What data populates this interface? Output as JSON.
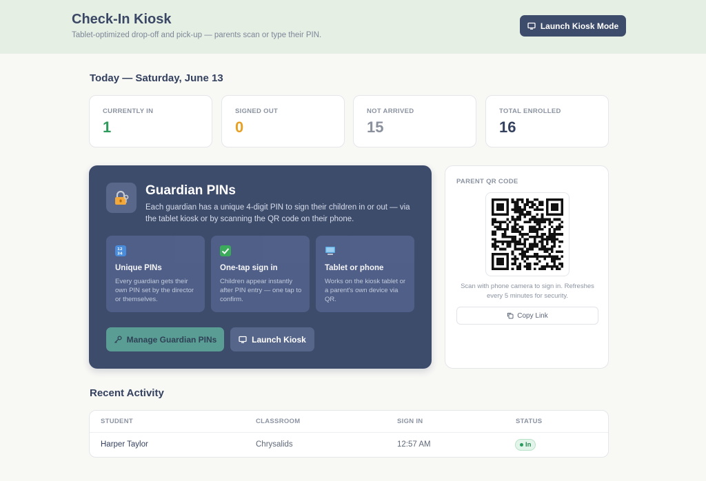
{
  "header": {
    "title": "Check-In Kiosk",
    "subtitle": "Tablet-optimized drop-off and pick-up — parents scan or type their PIN.",
    "launch_button": "Launch Kiosk Mode"
  },
  "today": {
    "heading": "Today — Saturday, June 13",
    "stats": [
      {
        "label": "CURRENTLY IN",
        "value": "1",
        "color": "#2e9a5c"
      },
      {
        "label": "SIGNED OUT",
        "value": "0",
        "color": "#e6a024"
      },
      {
        "label": "NOT ARRIVED",
        "value": "15",
        "color": "#8a909c"
      },
      {
        "label": "TOTAL ENROLLED",
        "value": "16",
        "color": "#34415e"
      }
    ]
  },
  "guardian_pins": {
    "title": "Guardian PINs",
    "description": "Each guardian has a unique 4-digit PIN to sign their children in or out — via the tablet kiosk or by scanning the QR code on their phone.",
    "features": [
      {
        "icon": "number-keypad-icon",
        "title": "Unique PINs",
        "description": "Every guardian gets their own PIN set by the director or themselves."
      },
      {
        "icon": "checkmark-icon",
        "title": "One-tap sign in",
        "description": "Children appear instantly after PIN entry — one tap to confirm."
      },
      {
        "icon": "computer-icon",
        "title": "Tablet or phone",
        "description": "Works on the kiosk tablet or a parent's own device via QR."
      }
    ],
    "manage_button": "Manage Guardian PINs",
    "launch_button": "Launch Kiosk"
  },
  "qr": {
    "label": "PARENT QR CODE",
    "caption": "Scan with phone camera to sign in. Refreshes every 5 minutes for security.",
    "copy_button": "Copy Link"
  },
  "activity": {
    "heading": "Recent Activity",
    "columns": [
      "STUDENT",
      "CLASSROOM",
      "SIGN IN",
      "STATUS"
    ],
    "rows": [
      {
        "student": "Harper Taylor",
        "classroom": "Chrysalids",
        "sign_in": "12:57 AM",
        "status": "In"
      }
    ]
  }
}
